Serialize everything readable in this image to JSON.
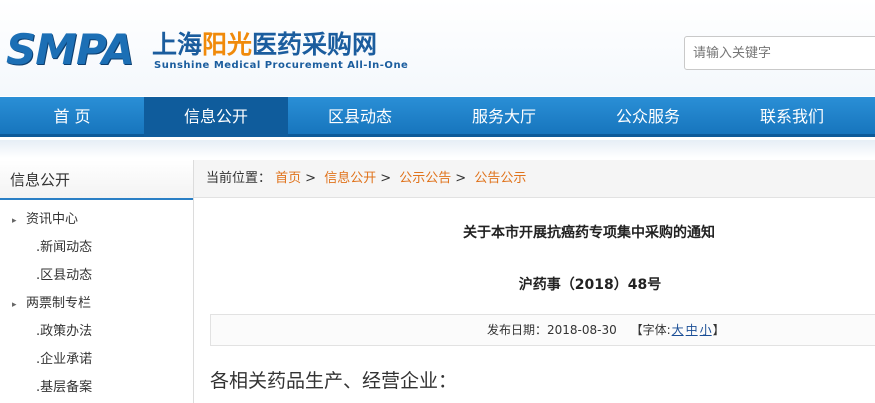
{
  "header": {
    "logo_mark": "SMPA",
    "logo_cn_1": "上海",
    "logo_cn_2": "阳光",
    "logo_cn_3": "医药采购网",
    "logo_en": "Sunshine Medical Procurement All-In-One",
    "search_placeholder": "请输入关键字"
  },
  "nav": {
    "items": [
      "首 页",
      "信息公开",
      "区县动态",
      "服务大厅",
      "公众服务",
      "联系我们"
    ]
  },
  "sidebar": {
    "title": "信息公开",
    "items": [
      {
        "label": "资讯中心"
      },
      {
        "label": ".新闻动态"
      },
      {
        "label": ".区县动态"
      },
      {
        "label": "两票制专栏"
      },
      {
        "label": ".政策办法"
      },
      {
        "label": ".企业承诺"
      },
      {
        "label": ".基层备案"
      }
    ]
  },
  "breadcrumb": {
    "prefix": "当前位置：",
    "items": [
      "首页",
      "信息公开",
      "公示公告",
      "公告公示"
    ],
    "separator": ">"
  },
  "article": {
    "title": "关于本市开展抗癌药专项集中采购的通知",
    "doc_number": "沪药事（2018）48号",
    "publish_label": "发布日期：2018-08-30",
    "font_label_open": "【字体:",
    "font_sizes": [
      "大",
      "中",
      "小"
    ],
    "font_label_close": "】",
    "salutation": "各相关药品生产、经营企业："
  },
  "colors": {
    "nav_blue": "#1775bd",
    "nav_active": "#0f5c9c",
    "link_orange": "#e0731c",
    "logo_blue": "#1c6fb5",
    "logo_orange": "#f08a0a"
  }
}
